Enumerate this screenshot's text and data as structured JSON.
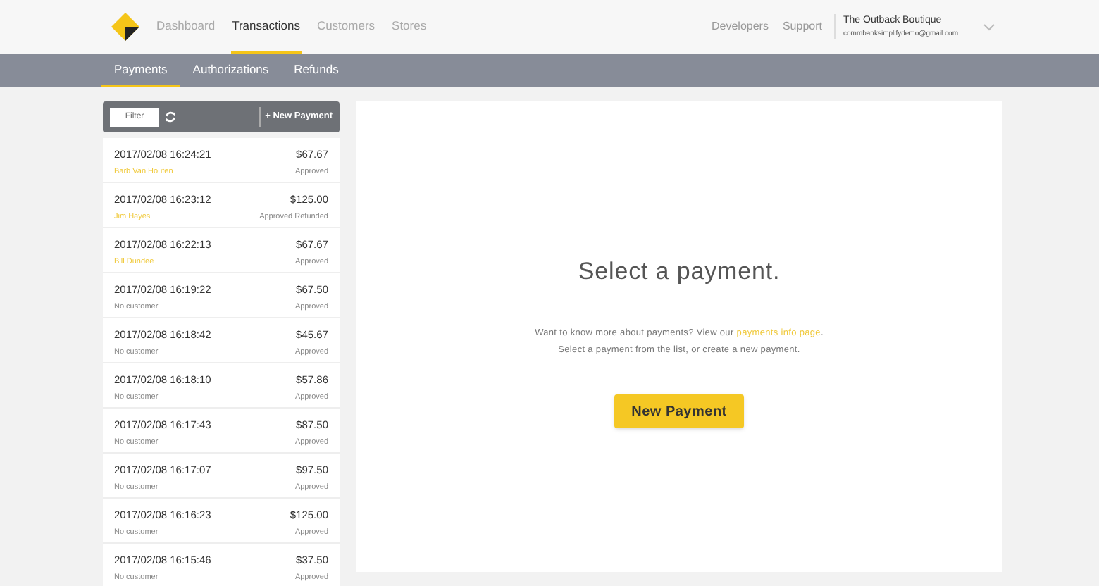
{
  "nav": [
    {
      "label": "Dashboard",
      "selected": false
    },
    {
      "label": "Transactions",
      "selected": true
    },
    {
      "label": "Customers",
      "selected": false
    },
    {
      "label": "Stores",
      "selected": false
    }
  ],
  "right_links": [
    "Developers",
    "Support"
  ],
  "account": {
    "name": "The Outback Boutique",
    "email": "commbanksimplifydemo@gmail.com"
  },
  "subnav": [
    {
      "label": "Payments",
      "selected": true
    },
    {
      "label": "Authorizations",
      "selected": false
    },
    {
      "label": "Refunds",
      "selected": false
    }
  ],
  "toolbar": {
    "filter": "Filter",
    "new_payment": "+ New Payment"
  },
  "payments": [
    {
      "date": "2017/02/08 16:24:21",
      "customer": "Barb Van Houten",
      "has_customer": true,
      "amount": "$67.67",
      "status": "Approved"
    },
    {
      "date": "2017/02/08 16:23:12",
      "customer": "Jim Hayes",
      "has_customer": true,
      "amount": "$125.00",
      "status": "Approved Refunded"
    },
    {
      "date": "2017/02/08 16:22:13",
      "customer": "Bill Dundee",
      "has_customer": true,
      "amount": "$67.67",
      "status": "Approved"
    },
    {
      "date": "2017/02/08 16:19:22",
      "customer": "No customer",
      "has_customer": false,
      "amount": "$67.50",
      "status": "Approved"
    },
    {
      "date": "2017/02/08 16:18:42",
      "customer": "No customer",
      "has_customer": false,
      "amount": "$45.67",
      "status": "Approved"
    },
    {
      "date": "2017/02/08 16:18:10",
      "customer": "No customer",
      "has_customer": false,
      "amount": "$57.86",
      "status": "Approved"
    },
    {
      "date": "2017/02/08 16:17:43",
      "customer": "No customer",
      "has_customer": false,
      "amount": "$87.50",
      "status": "Approved"
    },
    {
      "date": "2017/02/08 16:17:07",
      "customer": "No customer",
      "has_customer": false,
      "amount": "$97.50",
      "status": "Approved"
    },
    {
      "date": "2017/02/08 16:16:23",
      "customer": "No customer",
      "has_customer": false,
      "amount": "$125.00",
      "status": "Approved"
    },
    {
      "date": "2017/02/08 16:15:46",
      "customer": "No customer",
      "has_customer": false,
      "amount": "$37.50",
      "status": "Approved"
    }
  ],
  "detail": {
    "heading": "Select a payment.",
    "info_before": "Want to know more about payments? View our",
    "info_link": "payments info page",
    "info_after": ".",
    "info_line2": "Select a payment from the list, or create a new payment.",
    "button": "New Payment"
  }
}
